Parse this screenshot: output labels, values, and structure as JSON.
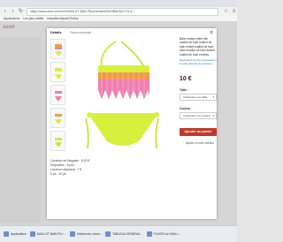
{
  "browser": {
    "url": "https://www.asoli.com/en/HAWLUT BAB Pièce/enfant/2523BaG5117213/...",
    "bookmarks": [
      "Applications",
      "Les plus visités",
      "Importés depuis Firefox"
    ]
  },
  "site": {
    "logo": "asoli"
  },
  "modal": {
    "close_symbol": "✕",
    "tabs": [
      "Détails",
      "Recommandé"
    ],
    "description": {
      "line1": "Livraison en Magasin : 6,20 €",
      "line2": "Disponible : 8 jour",
      "line3": "Livraison standard : 7 €",
      "line4": "5 jrs - 10 jrs"
    }
  },
  "panel": {
    "title": "Bikini enfant bébé fille maillot de bain maillot de bain enfant maillot de bain bikini maillot de bain enfant maillot de bain enfants",
    "note": "Découvrez le prix et la livraison à votre adresse de livraison",
    "price": "10 €",
    "size_label": "Taille :",
    "size_value": "Choisissez une taille",
    "color_label": "Couleur :",
    "color_value": "Choisissez une couleur",
    "add_label": "Ajouter au panier",
    "wishlist_label": "♡ Ajouter à votre wishlist"
  },
  "taskbar": [
    "Applications",
    "MAILLOT BAIN FILL...",
    "Vêtements, robes...",
    "TABLEAU GÉNÉRAL...",
    "PLACES de MAILL..."
  ],
  "colors": {
    "accent": "#c0392b",
    "bikini_green": "#d6f03c",
    "fringe_orange": "#f39a4a",
    "fringe_pink": "#f07fb0"
  }
}
